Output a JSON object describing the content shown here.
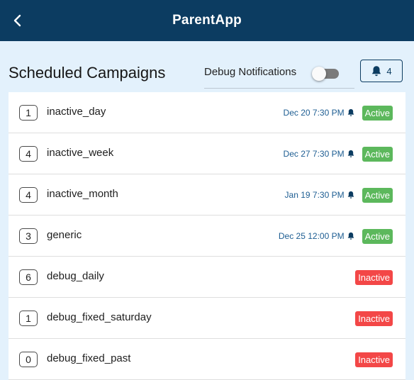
{
  "app": {
    "title": "ParentApp"
  },
  "header": {
    "title": "Scheduled Campaigns",
    "debug_label": "Debug Notifications",
    "debug_enabled": false,
    "bell_count": "4"
  },
  "campaigns": [
    {
      "count": "1",
      "name": "inactive_day",
      "time": "Dec 20 7:30 PM",
      "scheduled": true,
      "status": "Active"
    },
    {
      "count": "4",
      "name": "inactive_week",
      "time": "Dec 27 7:30 PM",
      "scheduled": true,
      "status": "Active"
    },
    {
      "count": "4",
      "name": "inactive_month",
      "time": "Jan 19 7:30 PM",
      "scheduled": true,
      "status": "Active"
    },
    {
      "count": "3",
      "name": "generic",
      "time": "Dec 25 12:00 PM",
      "scheduled": true,
      "status": "Active"
    },
    {
      "count": "6",
      "name": "debug_daily",
      "time": "",
      "scheduled": false,
      "status": "Inactive"
    },
    {
      "count": "1",
      "name": "debug_fixed_saturday",
      "time": "",
      "scheduled": false,
      "status": "Inactive"
    },
    {
      "count": "0",
      "name": "debug_fixed_past",
      "time": "",
      "scheduled": false,
      "status": "Inactive"
    }
  ],
  "icons": {
    "back": "chevron-left-icon",
    "bell": "bell-icon"
  },
  "colors": {
    "app_bar": "#0c3c61",
    "background": "#e3f1fc",
    "active": "#5cb85c",
    "inactive": "#f34747",
    "time_text": "#1d5d92"
  }
}
